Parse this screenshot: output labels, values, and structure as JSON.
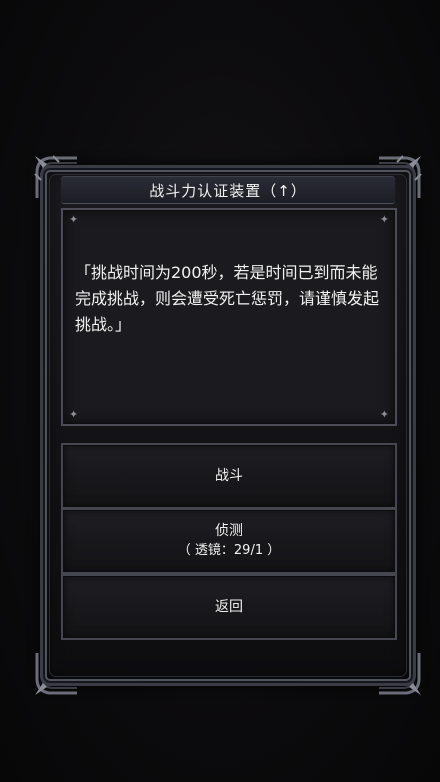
{
  "dialog": {
    "title": "战斗力认证装置（↑）",
    "message": "「挑战时间为200秒，若是时间已到而未能完成挑战，则会遭受死亡惩罚，请谨慎发起挑战。」"
  },
  "buttons": {
    "battle_label": "战斗",
    "detect_label": "侦测",
    "detect_sub": "（ 透镜：29/1 ）",
    "back_label": "返回"
  },
  "colors": {
    "background": "#0c0b0d",
    "frame": "#3a3b44",
    "panel": "#1b1b1f",
    "text": "#f2f2f2"
  }
}
